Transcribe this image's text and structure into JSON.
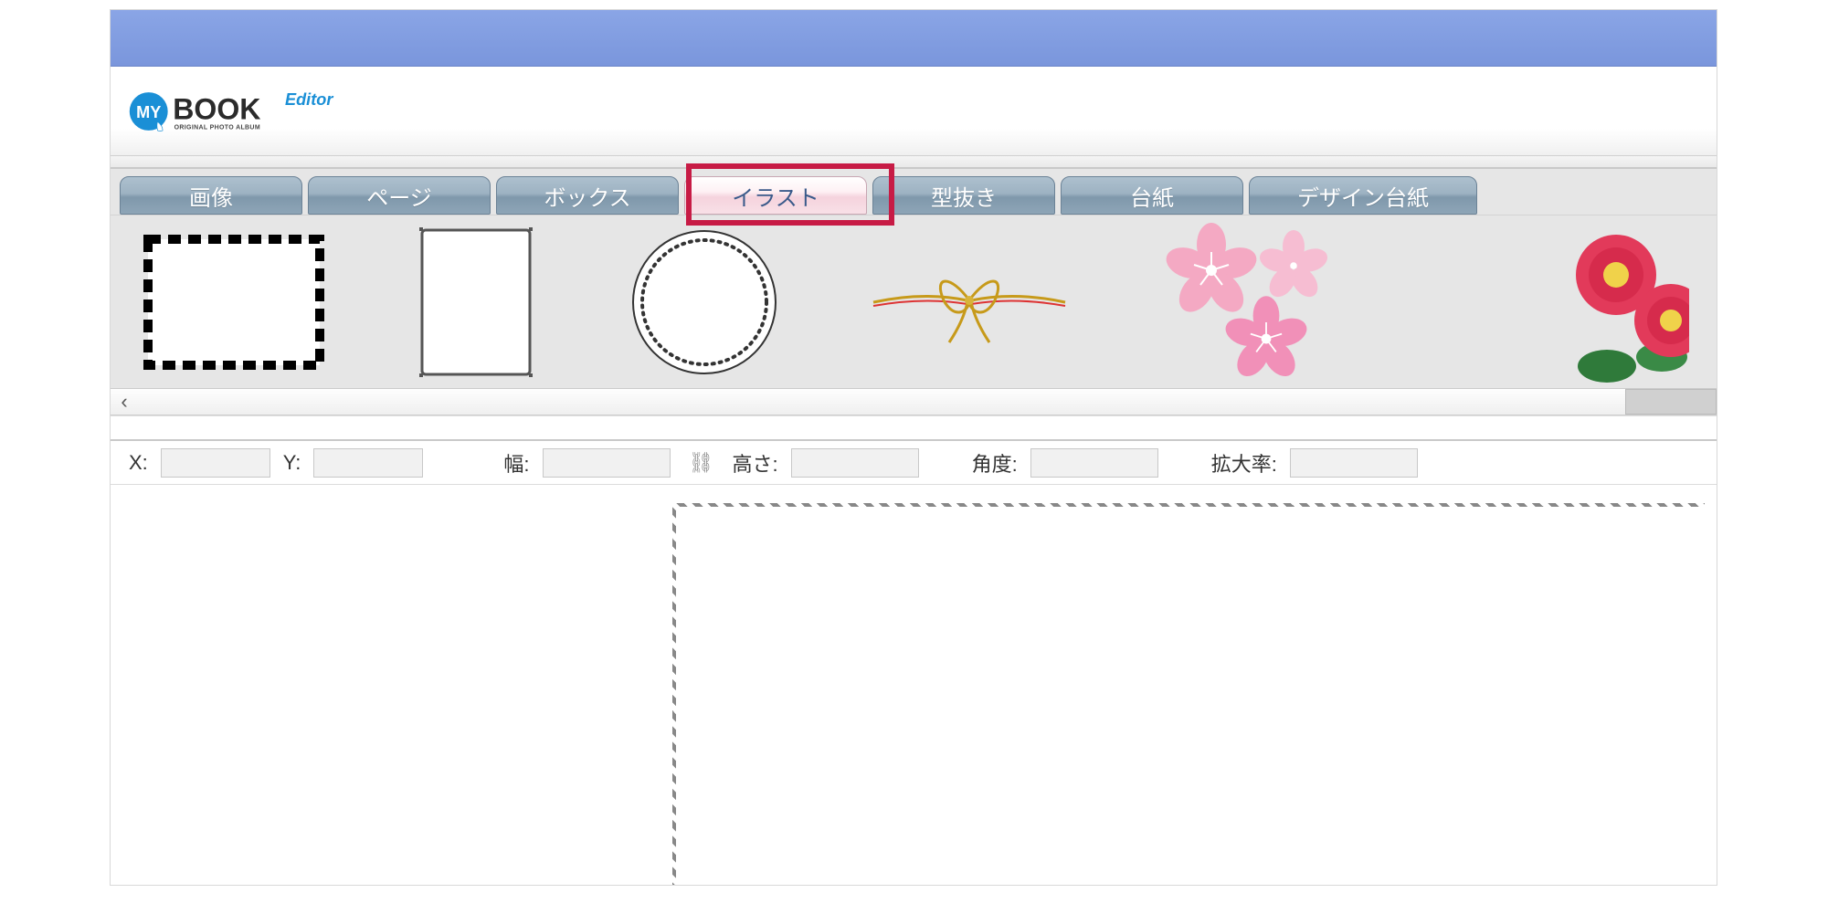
{
  "app": {
    "logo_main": "BOOK",
    "logo_sub": "Editor",
    "logo_tagline": "ORIGINAL PHOTO ALBUM",
    "logo_badge": "MY"
  },
  "tabs": [
    {
      "id": "image",
      "label": "画像",
      "active": false
    },
    {
      "id": "page",
      "label": "ページ",
      "active": false
    },
    {
      "id": "box",
      "label": "ボックス",
      "active": false
    },
    {
      "id": "illust",
      "label": "イラスト",
      "active": true
    },
    {
      "id": "diecut",
      "label": "型抜き",
      "active": false
    },
    {
      "id": "mount",
      "label": "台紙",
      "active": false
    },
    {
      "id": "design",
      "label": "デザイン台紙",
      "active": false
    }
  ],
  "illust_items": [
    {
      "name": "dashed-rectangle-frame"
    },
    {
      "name": "thin-rectangle-frame"
    },
    {
      "name": "dotted-circle-frame"
    },
    {
      "name": "gold-ribbon-bow"
    },
    {
      "name": "pink-sakura-cluster"
    },
    {
      "name": "red-camellia-cluster"
    }
  ],
  "properties": {
    "x_label": "X:",
    "x_value": "",
    "y_label": "Y:",
    "y_value": "",
    "width_label": "幅:",
    "width_value": "",
    "height_label": "高さ:",
    "height_value": "",
    "angle_label": "角度:",
    "angle_value": "",
    "zoom_label": "拡大率:",
    "zoom_value": ""
  },
  "scroll": {
    "left_arrow": "‹"
  }
}
